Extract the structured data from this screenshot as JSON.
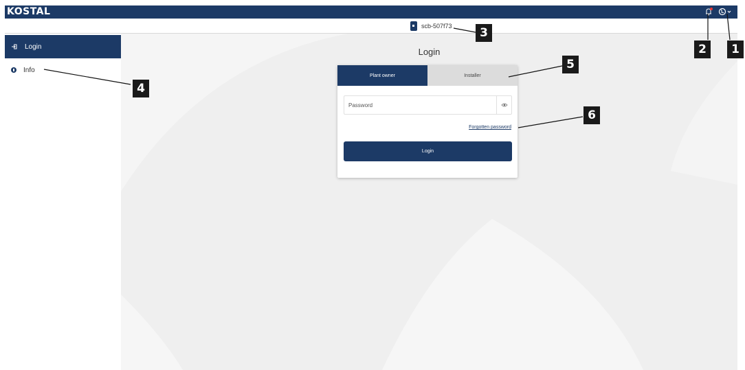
{
  "header": {
    "logo": "KOSTAL",
    "notification_icon": "bell-icon",
    "language_icon": "globe-icon",
    "notification_badge_color": "#e53935",
    "brand_color": "#1c3a66"
  },
  "device": {
    "name": "scb-507f73",
    "icon": "inverter-icon"
  },
  "sidebar": {
    "items": [
      {
        "label": "Login",
        "icon": "login-icon",
        "active": true
      },
      {
        "label": "Info",
        "icon": "info-icon",
        "active": false
      }
    ]
  },
  "login": {
    "title": "Login",
    "tabs": [
      {
        "label": "Plant owner",
        "active": true
      },
      {
        "label": "Installer",
        "active": false
      }
    ],
    "password_placeholder": "Password",
    "password_value": "",
    "show_password_icon": "eye-icon",
    "forgot_link": "Forgotten password",
    "submit_label": "Login"
  },
  "callouts": [
    "1",
    "2",
    "3",
    "4",
    "5",
    "6"
  ]
}
